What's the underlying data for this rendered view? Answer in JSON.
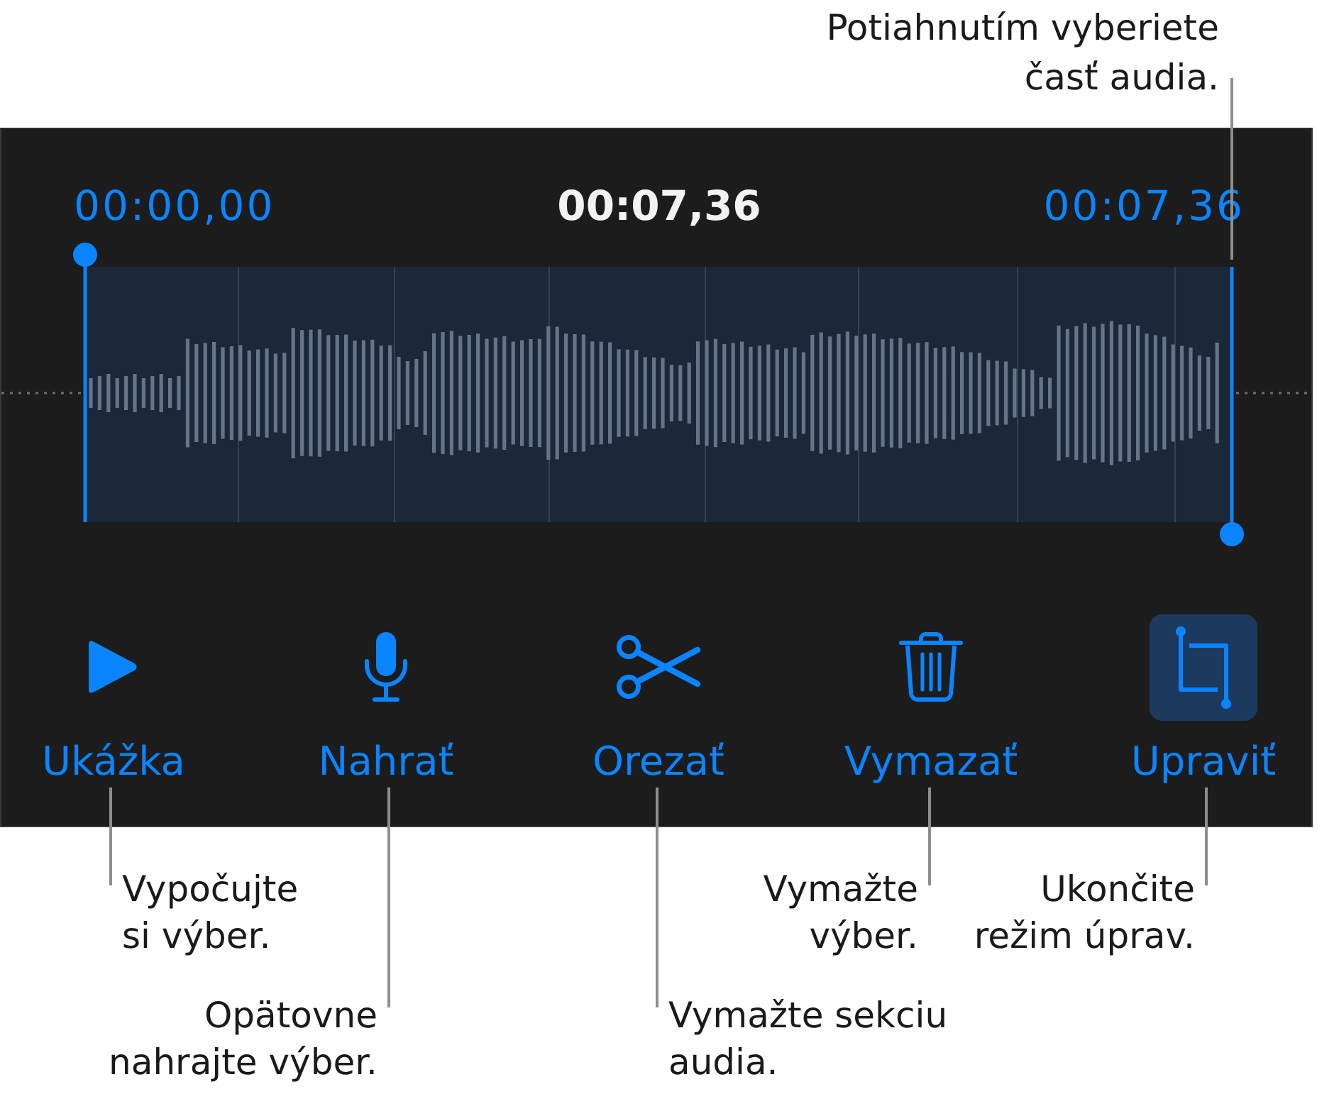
{
  "drag_hint": {
    "text": "Potiahnutím vyberiete\nčasť audia."
  },
  "editor": {
    "times": [
      {
        "kind": "selection-start",
        "text": "00:00,00"
      },
      {
        "kind": "playhead",
        "text": "00:07,36"
      },
      {
        "kind": "selection-end",
        "text": "00:07,36"
      }
    ],
    "tools": [
      {
        "kind": "play",
        "label": "Ukážka",
        "selected": false
      },
      {
        "kind": "record",
        "label": "Nahrať",
        "selected": false
      },
      {
        "kind": "trim",
        "label": "Orezať",
        "selected": false
      },
      {
        "kind": "delete",
        "label": "Vymazať",
        "selected": false
      },
      {
        "kind": "crop",
        "label": "Upraviť",
        "selected": true
      }
    ]
  },
  "callouts": [
    {
      "text": "Vypočujte\nsi výber."
    },
    {
      "text": "Vymažte\nvýber."
    },
    {
      "text": "Ukončite\nrežim úprav."
    },
    {
      "text": "Opätovne\nnahrajte výber."
    },
    {
      "text": "Vymažte sekciu\naudia."
    }
  ]
}
